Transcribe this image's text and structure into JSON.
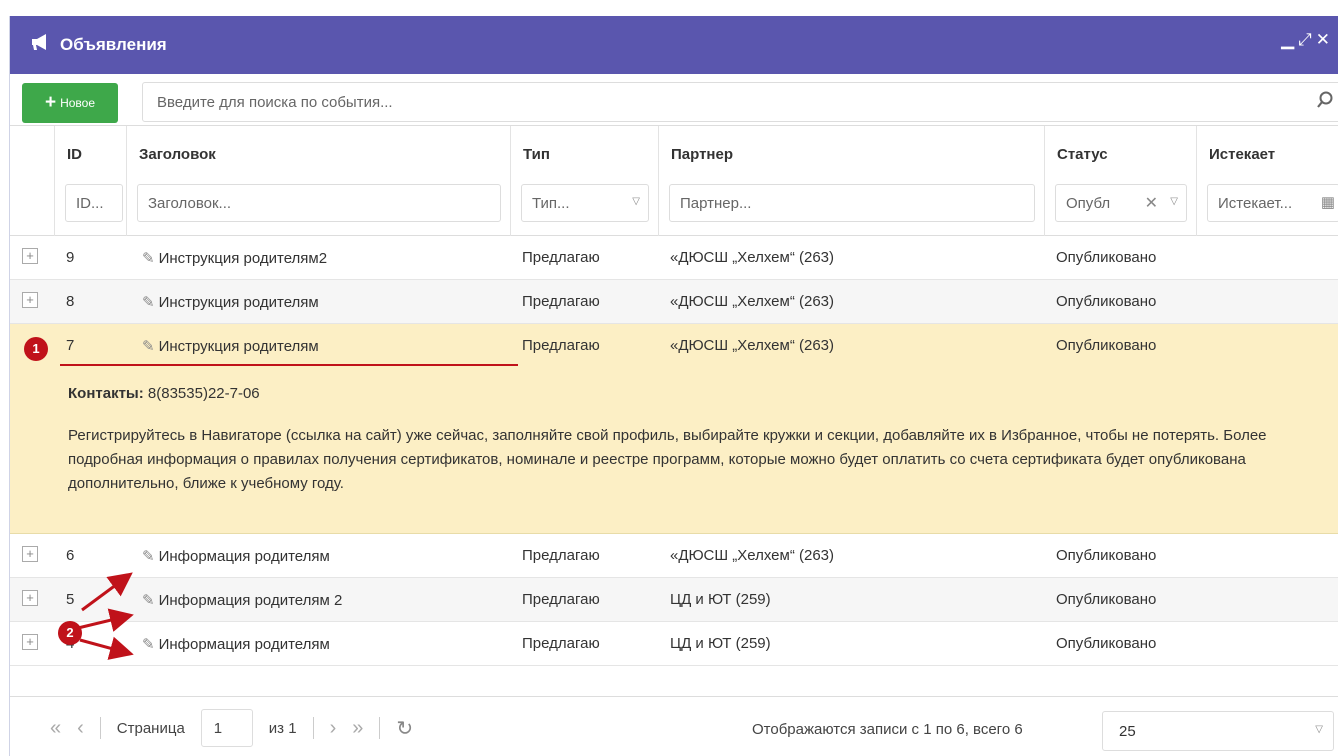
{
  "window": {
    "title": "Объявления",
    "minimize_icon": "minimize-icon",
    "maximize_icon": "maximize-icon",
    "close_icon": "close-icon"
  },
  "toolbar": {
    "new_label": "Новое",
    "search_placeholder": "Введите для поиска по события..."
  },
  "columns": [
    {
      "key": "id",
      "label": "ID",
      "filter": "ID..."
    },
    {
      "key": "title",
      "label": "Заголовок",
      "filter": "Заголовок..."
    },
    {
      "key": "type",
      "label": "Тип",
      "filter": "Тип..."
    },
    {
      "key": "partner",
      "label": "Партнер",
      "filter": "Партнер..."
    },
    {
      "key": "status",
      "label": "Статус",
      "filter": "Опубл"
    },
    {
      "key": "expires",
      "label": "Истекает",
      "filter": "Истекает..."
    }
  ],
  "rows": [
    {
      "id": "9",
      "title": "Инструкция родителям2",
      "type": "Предлагаю",
      "partner": "«ДЮСШ „Хелхем“ (263)",
      "status": "Опубликовано"
    },
    {
      "id": "8",
      "title": "Инструкция родителям",
      "type": "Предлагаю",
      "partner": "«ДЮСШ „Хелхем“ (263)",
      "status": "Опубликовано"
    },
    {
      "id": "7",
      "title": "Инструкция родителям",
      "type": "Предлагаю",
      "partner": "«ДЮСШ „Хелхем“ (263)",
      "status": "Опубликовано"
    },
    {
      "id": "6",
      "title": "Информация родителям",
      "type": "Предлагаю",
      "partner": "«ДЮСШ „Хелхем“ (263)",
      "status": "Опубликовано"
    },
    {
      "id": "5",
      "title": "Информация родителям 2",
      "type": "Предлагаю",
      "partner": "ЦД и ЮТ (259)",
      "status": "Опубликовано"
    },
    {
      "id": "4",
      "title": "Информация родителям",
      "type": "Предлагаю",
      "partner": "ЦД и ЮТ (259)",
      "status": "Опубликовано"
    }
  ],
  "detail": {
    "contacts_label": "Контакты:",
    "contacts_value": "8(83535)22-7-06",
    "text": "Регистрируйтесь в Навигаторе (ссылка на сайт) уже сейчас, заполняйте свой профиль, выбирайте кружки и секции, добавляйте их в Избранное, чтобы не потерять. Более подробная информация о правилах получения сертификатов, номинале и реестре программ, которые можно будет оплатить со счета сертификата будет опубликована дополнительно, ближе к учебному году."
  },
  "annotations": {
    "badge1": "1",
    "badge2": "2"
  },
  "pager": {
    "page_label": "Страница",
    "page_value": "1",
    "of_label": "из 1",
    "info": "Отображаются записи с 1 по 6, всего 6",
    "page_size": "25"
  },
  "colors": {
    "titlebar": "#5a56ae",
    "new_button": "#3ea84a",
    "selected_row": "#fcefc5",
    "annotation": "#c0121a"
  }
}
